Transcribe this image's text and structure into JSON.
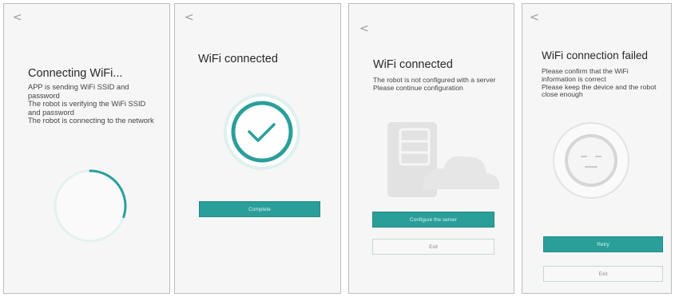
{
  "screens": [
    {
      "back_glyph": "<",
      "title": "Connecting WiFi...",
      "lines": [
        "APP is sending WiFi SSID and password",
        "The robot is verifying the WiFi SSID and password",
        "The robot is connecting to the network"
      ],
      "icon": "loading-spinner-icon",
      "progress": 0.3
    },
    {
      "back_glyph": "<",
      "title": "WiFi connected",
      "icon": "checkmark-circle-icon",
      "primary_button": "Complete"
    },
    {
      "back_glyph": "<",
      "title": "WiFi connected",
      "lines": [
        "The robot is not configured with a server",
        "Please continue configuration"
      ],
      "icon": "server-cloud-icon",
      "primary_button": "Configure the server",
      "secondary_button": "Exit"
    },
    {
      "back_glyph": "<",
      "title": "WiFi connection failed",
      "lines": [
        "Please confirm that the WiFi information is correct",
        "Please keep the device and the robot close enough"
      ],
      "icon": "sad-face-icon",
      "primary_button": "Retry",
      "secondary_button": "Exit"
    }
  ],
  "colors": {
    "accent": "#2a9f9a",
    "ring": "#d9efee",
    "panel": "#f6f6f6",
    "border": "#bdbdbd"
  }
}
